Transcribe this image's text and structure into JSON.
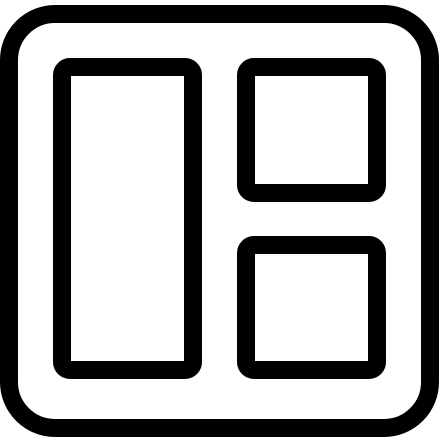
{
  "icon": {
    "name": "dashboard-layout-icon",
    "stroke_color": "#000000",
    "fill_color": "#ffffff"
  }
}
